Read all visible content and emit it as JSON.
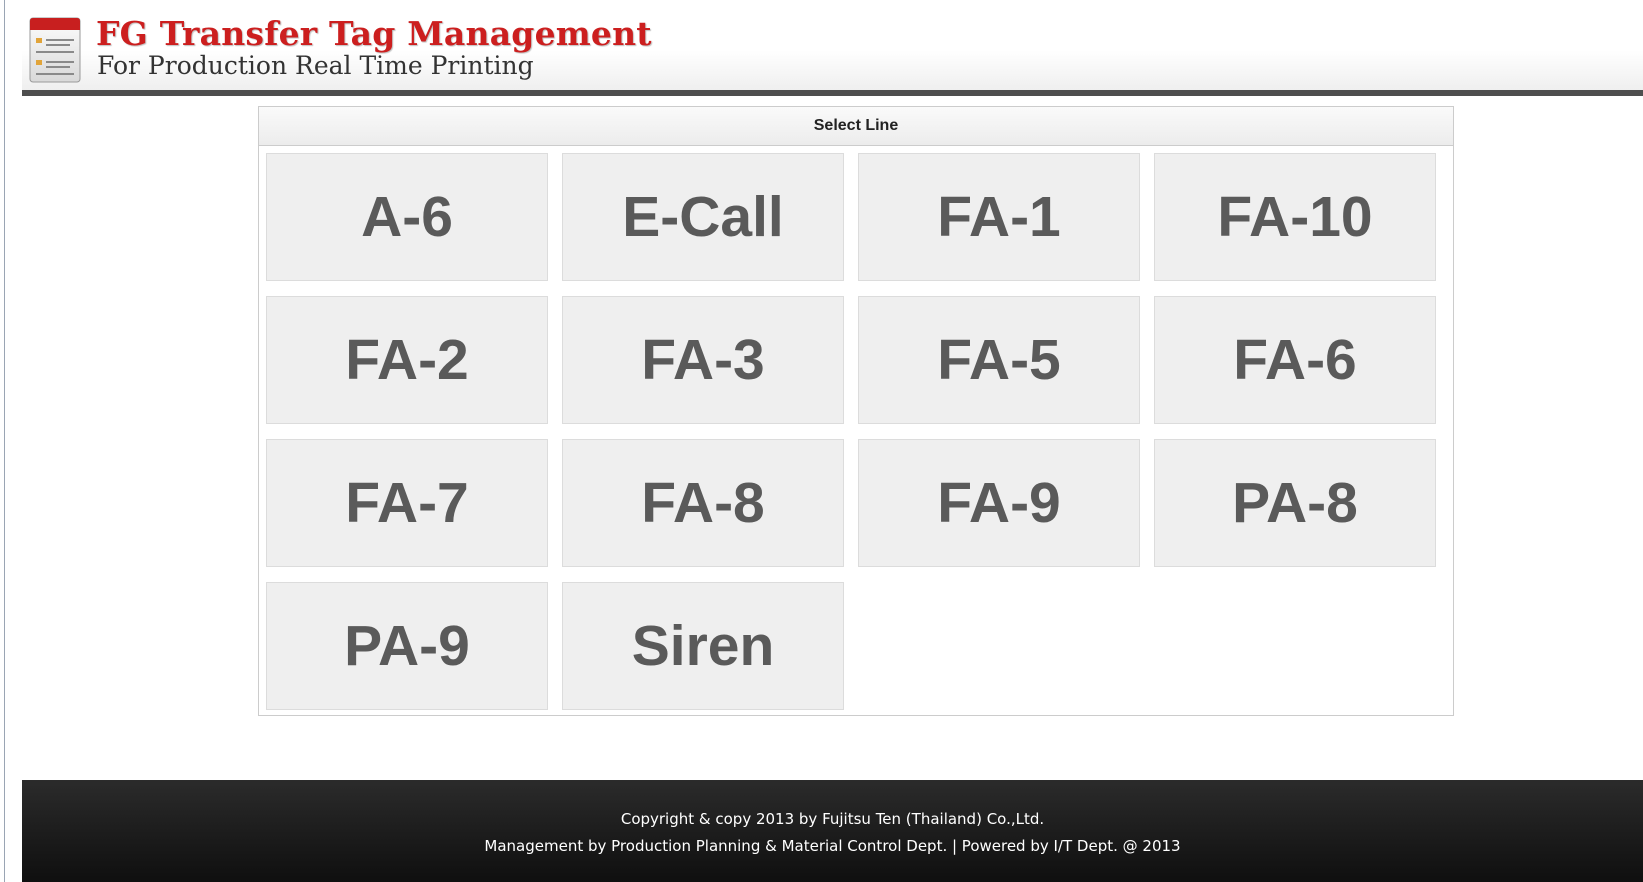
{
  "header": {
    "title": "FG Transfer Tag  Management",
    "subtitle": "For Production Real Time Printing",
    "logo_icon": "document-list-icon"
  },
  "panel": {
    "header": "Select Line",
    "lines": [
      {
        "label": "A-6"
      },
      {
        "label": "E-Call"
      },
      {
        "label": "FA-1"
      },
      {
        "label": "FA-10"
      },
      {
        "label": "FA-2"
      },
      {
        "label": "FA-3"
      },
      {
        "label": "FA-5"
      },
      {
        "label": "FA-6"
      },
      {
        "label": "FA-7"
      },
      {
        "label": "FA-8"
      },
      {
        "label": "FA-9"
      },
      {
        "label": "PA-8"
      },
      {
        "label": "PA-9"
      },
      {
        "label": "Siren"
      }
    ]
  },
  "footer": {
    "line1": "Copyright & copy 2013 by Fujitsu Ten (Thailand) Co.,Ltd.",
    "line2": "Management by Production Planning & Material Control Dept. | Powered by I/T Dept. @ 2013"
  },
  "colors": {
    "title_red": "#cc1f1f",
    "header_bar": "#4e4e4e",
    "button_bg": "#efefef",
    "button_text": "#5a5a5a",
    "footer_bg": "#1a1a1a"
  }
}
